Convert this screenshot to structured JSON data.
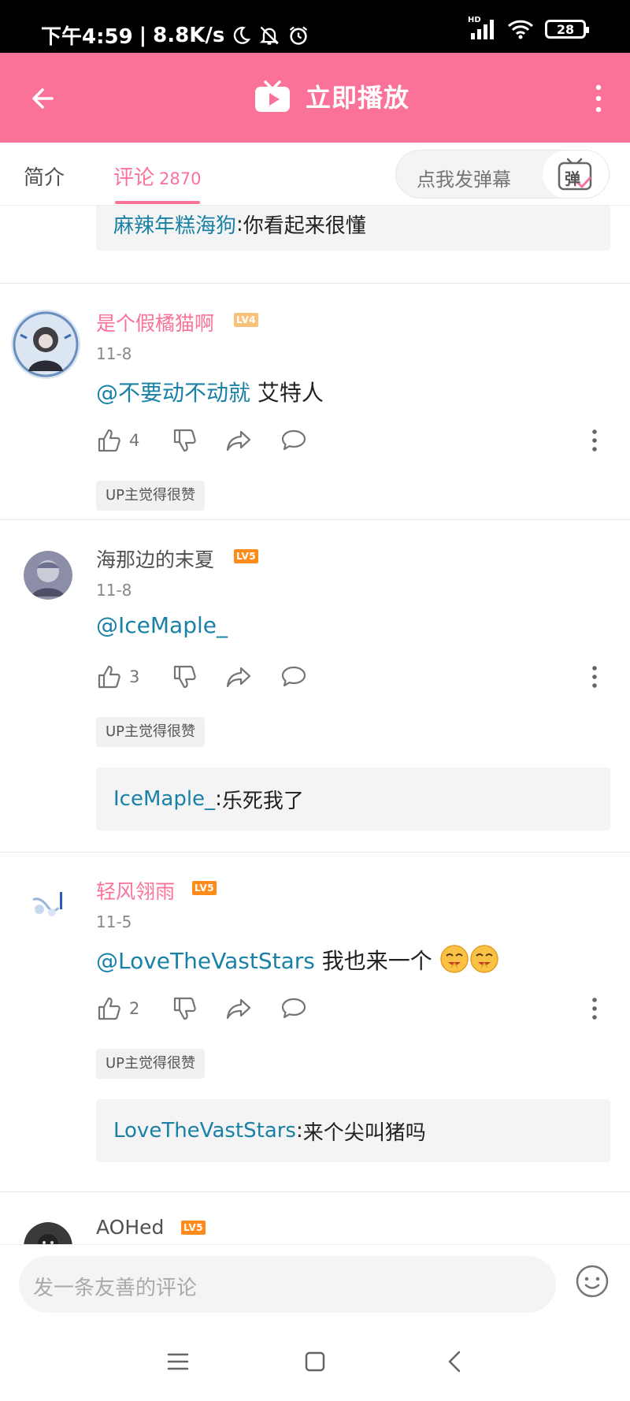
{
  "status_bar": {
    "time": "下午4:59",
    "speed": "8.8K/s",
    "network": "HD",
    "battery": "28"
  },
  "header": {
    "title": "立即播放",
    "accent_color": "#fb7299"
  },
  "tabs": {
    "intro": "简介",
    "comments": "评论",
    "comments_count": "2870",
    "danmaku_placeholder": "点我发弹幕",
    "danmaku_icon_label": "弹"
  },
  "top_reply": {
    "user": "麻辣年糕海狗",
    "sep": ": ",
    "text": "你看起来很懂"
  },
  "comments": [
    {
      "username": "是个假橘猫啊",
      "level": "LV4",
      "date": "11-8",
      "mention": "@不要动不动就",
      "text": " 艾特人",
      "likes": "4",
      "badge": "UP主觉得很赞"
    },
    {
      "username": "海那边的末夏",
      "level": "LV5",
      "date": "11-8",
      "mention": "@IceMaple_",
      "text": "",
      "likes": "3",
      "badge": "UP主觉得很赞",
      "reply_user": "IceMaple_",
      "reply_sep": ": ",
      "reply_text": "乐死我了"
    },
    {
      "username": "轻风翎雨",
      "level": "LV5",
      "date": "11-5",
      "mention": "@LoveTheVastStars",
      "text": " 我也来一个",
      "likes": "2",
      "badge": "UP主觉得很赞",
      "reply_user": "LoveTheVastStars",
      "reply_sep": ": ",
      "reply_text": "来个尖叫猪吗"
    },
    {
      "username": "AOHed",
      "level": "LV5"
    }
  ],
  "input": {
    "placeholder": "发一条友善的评论"
  }
}
